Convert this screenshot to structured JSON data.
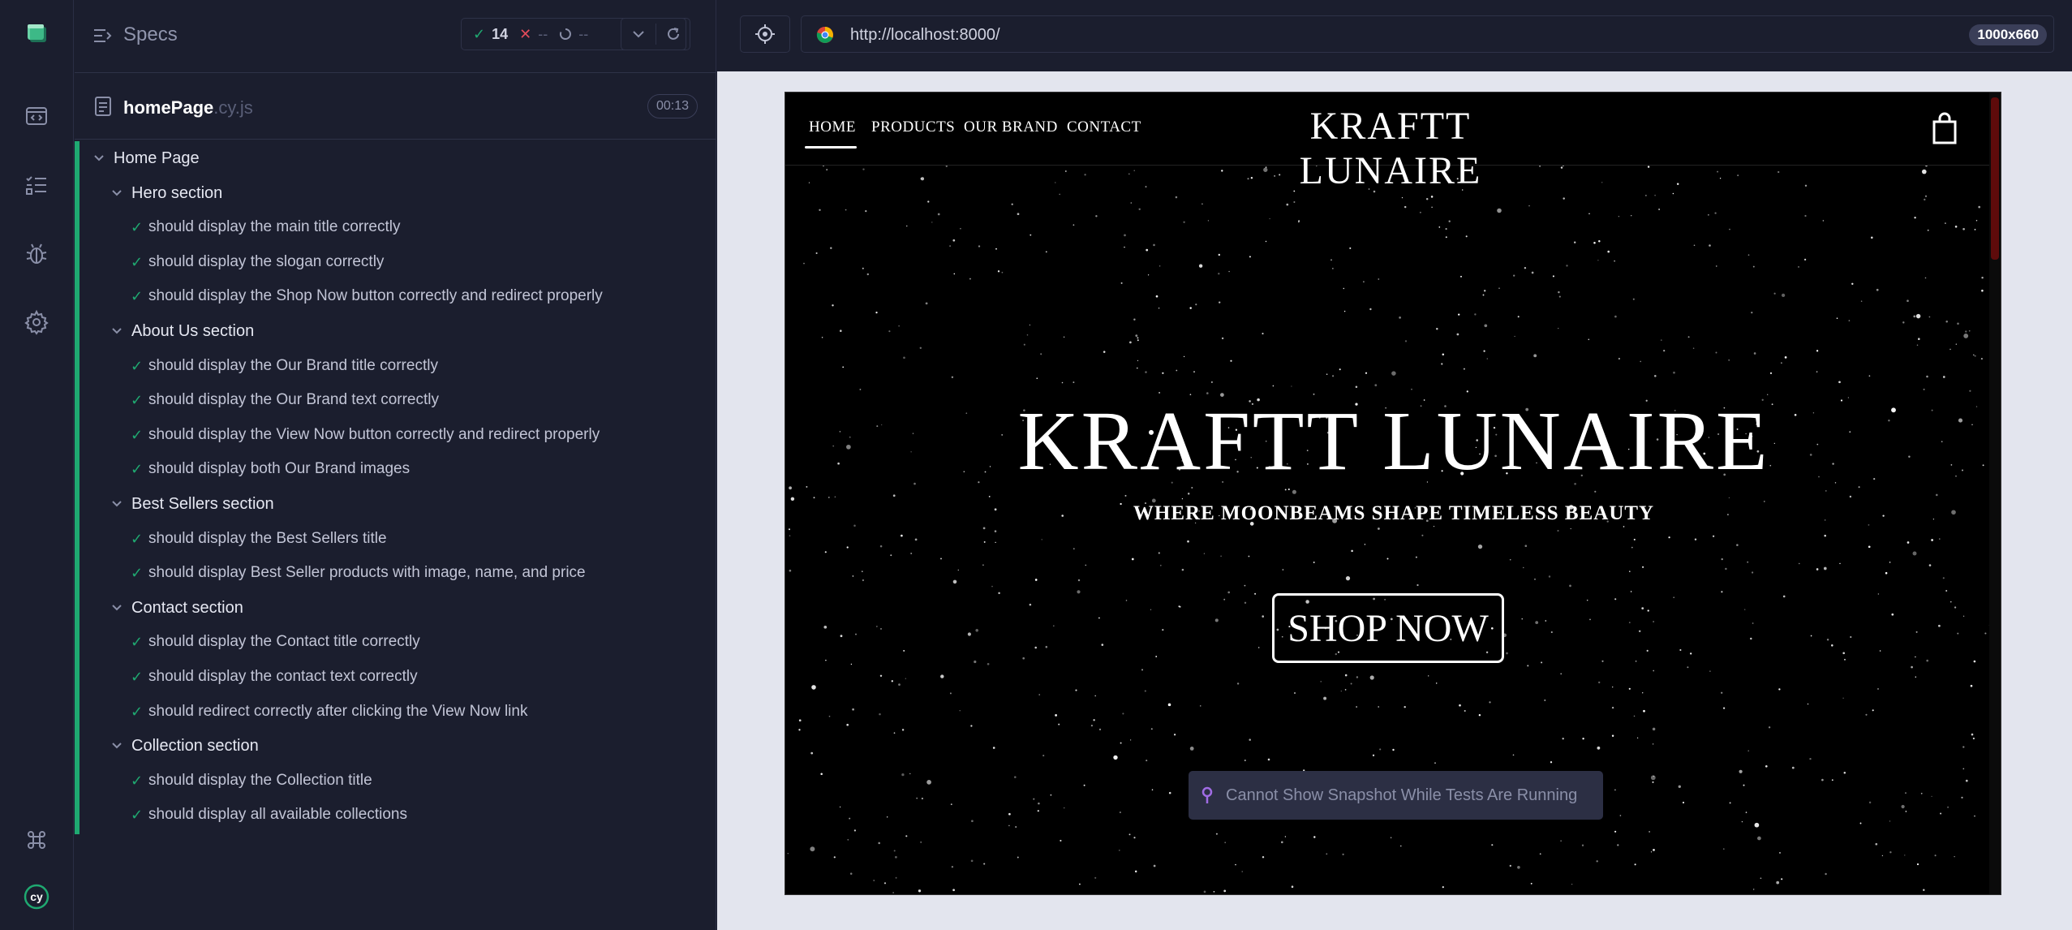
{
  "reporter": {
    "header": {
      "title": "Specs",
      "passed": "14",
      "failed": "--",
      "pending": "--"
    },
    "file": {
      "name": "homePage",
      "ext": ".cy.js",
      "duration": "00:13"
    },
    "tree": [
      {
        "type": "suite",
        "depth": 0,
        "label": "Home Page"
      },
      {
        "type": "suite",
        "depth": 1,
        "label": "Hero section"
      },
      {
        "type": "test",
        "label": "should display the main title correctly"
      },
      {
        "type": "test",
        "label": "should display the slogan correctly"
      },
      {
        "type": "test",
        "label": "should display the Shop Now button correctly and redirect properly"
      },
      {
        "type": "suite",
        "depth": 1,
        "label": "About Us section"
      },
      {
        "type": "test",
        "label": "should display the Our Brand title correctly"
      },
      {
        "type": "test",
        "label": "should display the Our Brand text correctly"
      },
      {
        "type": "test",
        "label": "should display the View Now button correctly and redirect properly"
      },
      {
        "type": "test",
        "label": "should display both Our Brand images"
      },
      {
        "type": "suite",
        "depth": 1,
        "label": "Best Sellers section"
      },
      {
        "type": "test",
        "label": "should display the Best Sellers title"
      },
      {
        "type": "test",
        "label": "should display Best Seller products with image, name, and price"
      },
      {
        "type": "suite",
        "depth": 1,
        "label": "Contact section"
      },
      {
        "type": "test",
        "label": "should display the Contact title correctly"
      },
      {
        "type": "test",
        "label": "should display the contact text correctly"
      },
      {
        "type": "test",
        "label": "should redirect correctly after clicking the View Now link"
      },
      {
        "type": "suite",
        "depth": 1,
        "label": "Collection section"
      },
      {
        "type": "test",
        "label": "should display the Collection title"
      },
      {
        "type": "test",
        "label": "should display all available collections"
      }
    ]
  },
  "browser": {
    "url": "http://localhost:8000/",
    "viewport": "1000x660"
  },
  "site": {
    "nav": [
      "HOME",
      "PRODUCTS",
      "OUR BRAND",
      "CONTACT"
    ],
    "logo": "KRAFTT LUNAIRE",
    "hero_title": "KRAFTT LUNAIRE",
    "slogan": "WHERE MOONBEAMS SHAPE TIMELESS BEAUTY",
    "shop_button": "SHOP NOW"
  },
  "snapshot_message": "Cannot Show Snapshot While Tests Are Running",
  "colors": {
    "pass": "#1fa971",
    "fail": "#e34b5a",
    "bg": "#1b1e2e",
    "snapshot_pin": "#a06ce4"
  }
}
